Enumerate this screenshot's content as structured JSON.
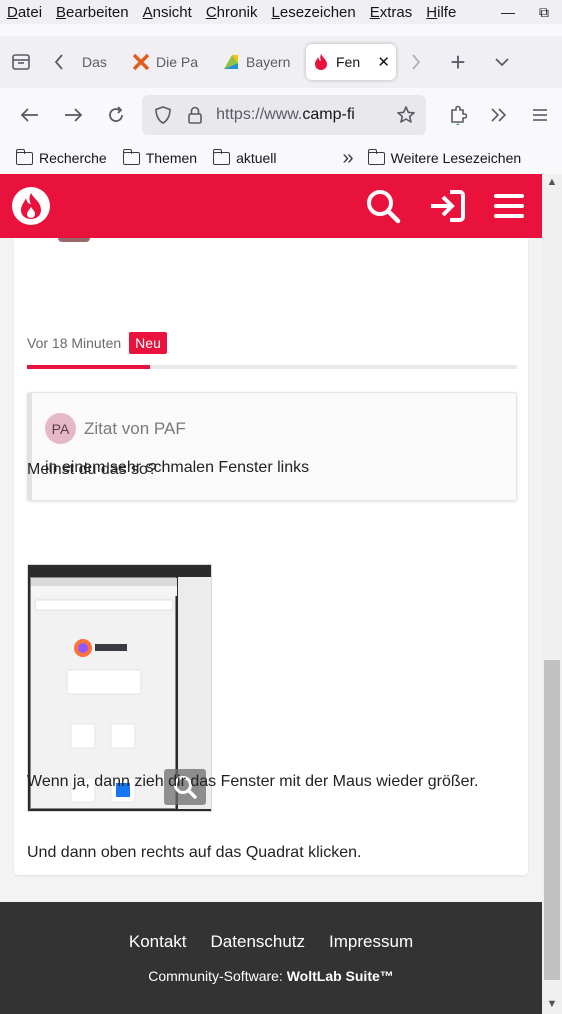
{
  "menu": {
    "items": [
      {
        "key": "D",
        "rest": "atei"
      },
      {
        "key": "B",
        "rest": "earbeiten"
      },
      {
        "key": "A",
        "rest": "nsicht"
      },
      {
        "key": "C",
        "rest": "hronik"
      },
      {
        "key": "L",
        "rest": "esezeichen"
      },
      {
        "key": "E",
        "rest": "xtras"
      },
      {
        "key": "H",
        "rest": "ilfe"
      }
    ],
    "minimize_glyph": "—",
    "restore_glyph": "⧉"
  },
  "tabs": [
    {
      "title": "Das",
      "icon": "page-icon"
    },
    {
      "title": "Die Pa",
      "icon": "x-logo-icon"
    },
    {
      "title": "Bayern",
      "icon": "bayern-icon"
    },
    {
      "title": "Fen",
      "icon": "flame-icon",
      "active": true
    }
  ],
  "tab_close_glyph": "✕",
  "new_tab_glyph": "+",
  "url": {
    "prefix": "https://www.",
    "host": "camp-fi"
  },
  "bookmarks": [
    {
      "label": "Recherche"
    },
    {
      "label": "Themen"
    },
    {
      "label": "aktuell"
    }
  ],
  "bookmarks_overflow_glyph": "»",
  "bookmarks_more": "Weitere Lesezeichen",
  "post": {
    "time": "Vor 18 Minuten",
    "badge": "Neu",
    "read_progress": 0.25,
    "quote_avatar": "PA",
    "quote_author": "Zitat von PAF",
    "quote_text": "in einem sehr schmalen Fenster links",
    "paragraph1": "Meinst du das so?",
    "paragraph2": "Wenn ja, dann zieh dir das Fenster mit der Maus wieder größer.",
    "paragraph3": "Und dann oben rechts auf das Quadrat klicken."
  },
  "footer": {
    "links": [
      "Kontakt",
      "Datenschutz",
      "Impressum"
    ],
    "credit_prefix": "Community-Software: ",
    "credit_brand": "WoltLab Suite™"
  },
  "colors": {
    "brand": "#e8123c",
    "footer_bg": "#333333"
  }
}
